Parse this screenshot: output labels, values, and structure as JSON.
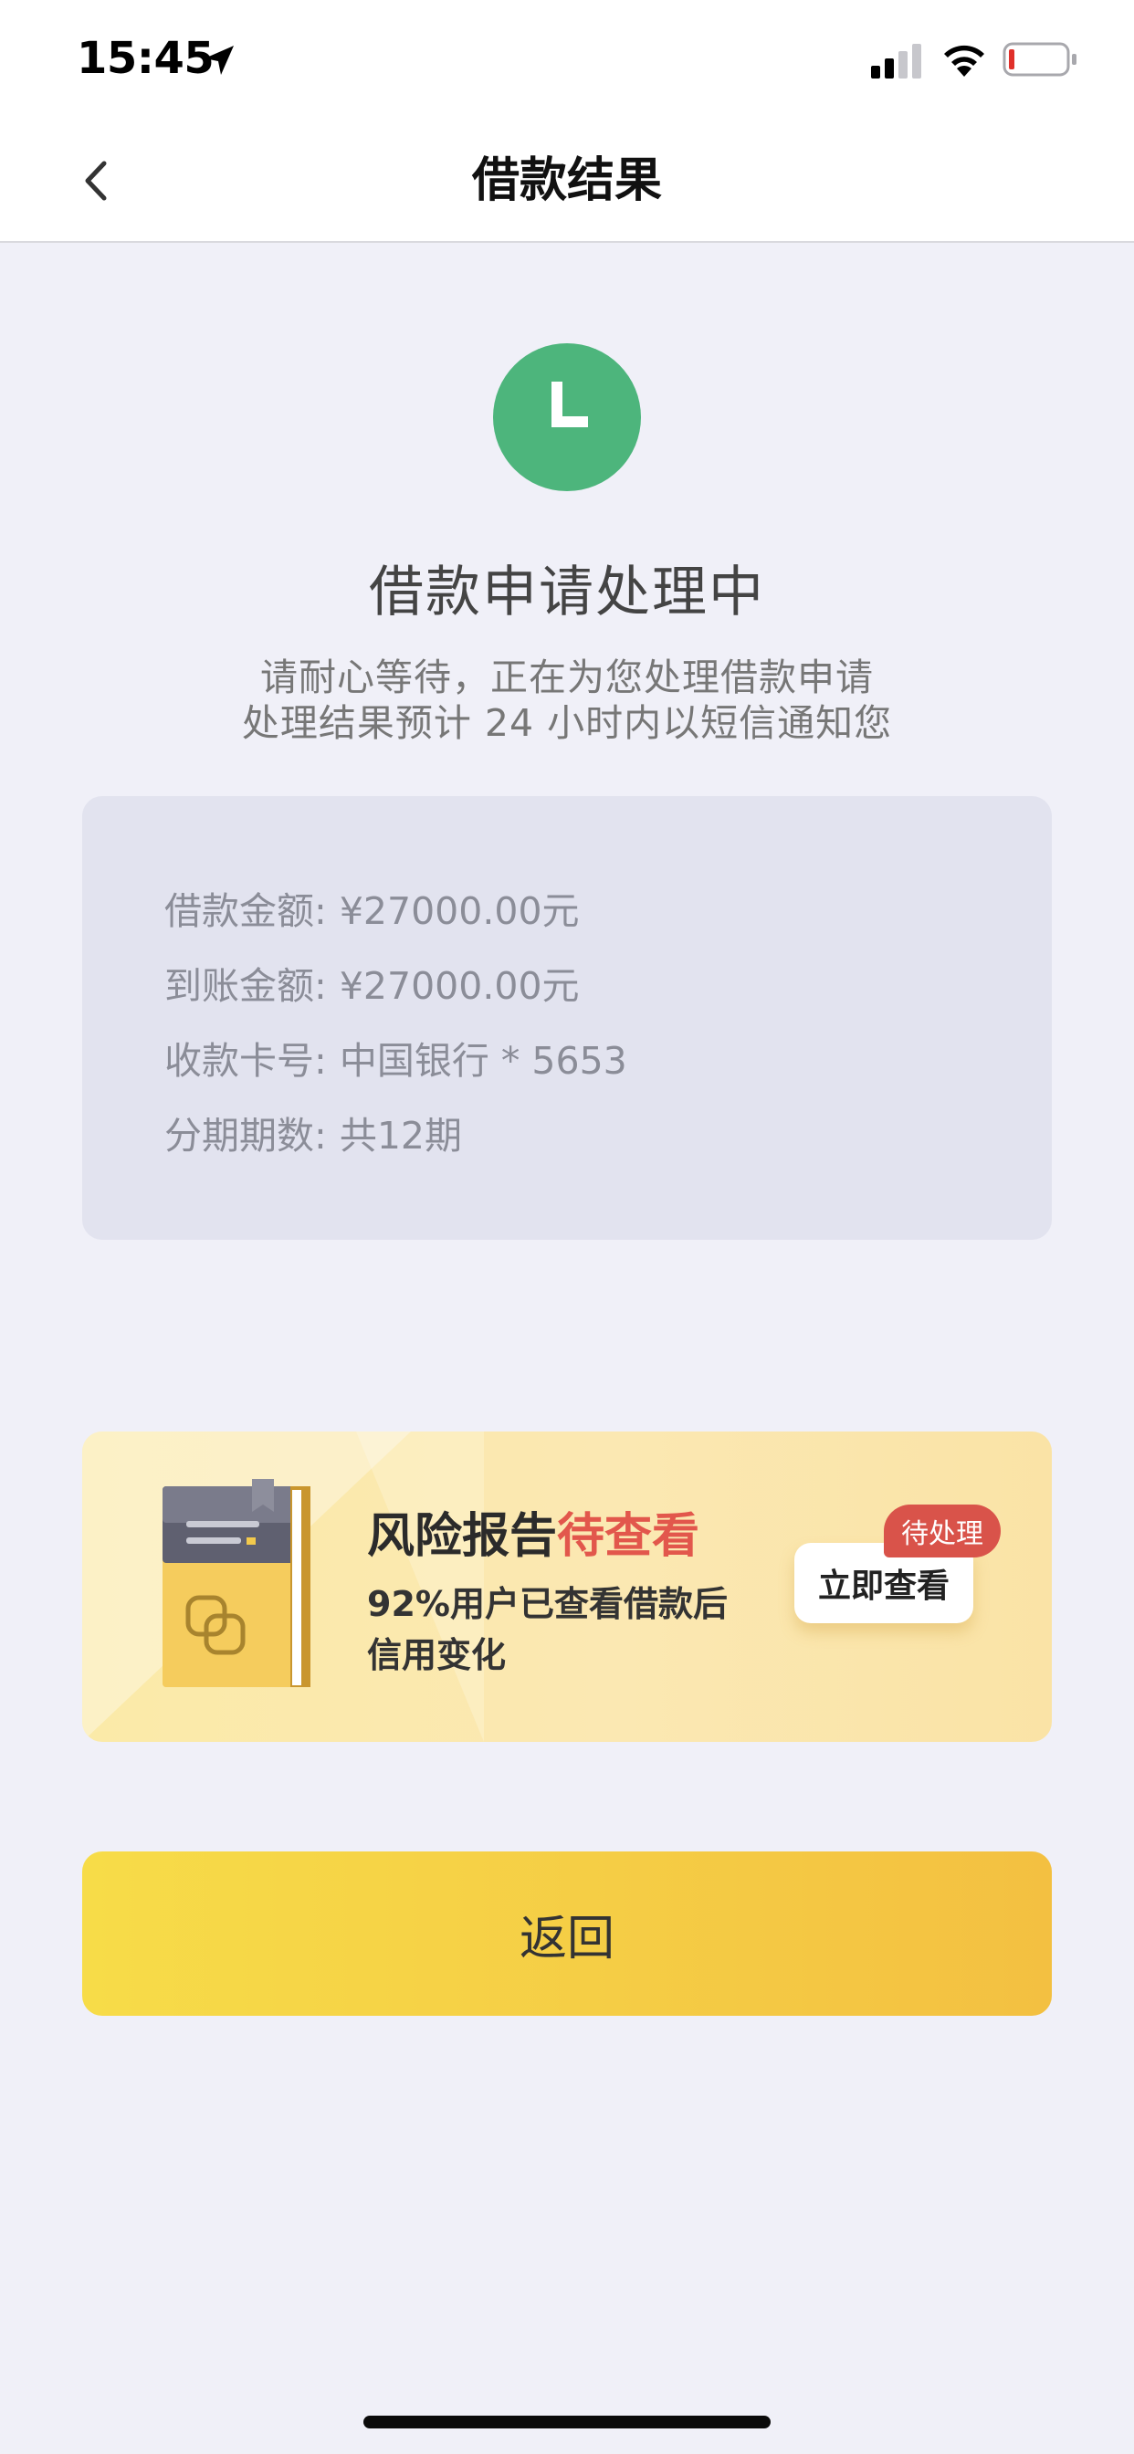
{
  "status_bar": {
    "time": "15:45",
    "icons": [
      "location-arrow-icon",
      "cellular-signal-icon",
      "wifi-icon",
      "battery-low-icon"
    ]
  },
  "nav": {
    "title": "借款结果",
    "back_icon": "chevron-left-icon"
  },
  "status": {
    "icon": "clock-icon",
    "icon_color": "#4db57c",
    "heading": "借款申请处理中",
    "description_lines": [
      "请耐心等待，正在为您处理借款申请",
      "处理结果预计 24 小时内以短信通知您"
    ]
  },
  "loan_details": [
    {
      "label": "借款金额:",
      "value": "¥27000.00元"
    },
    {
      "label": "到账金额:",
      "value": "¥27000.00元"
    },
    {
      "label": "收款卡号:",
      "value": "中国银行 * 5653"
    },
    {
      "label": "分期期数:",
      "value": "共12期"
    }
  ],
  "risk_banner": {
    "icon": "report-book-icon",
    "title_prefix": "风险报告",
    "title_highlight": "待查看",
    "subtitle_lines": [
      "92%用户已查看借款后",
      "信用变化"
    ],
    "badge": "待处理",
    "button_label": "立即查看",
    "highlight_color": "#e2574c"
  },
  "actions": {
    "return_label": "返回"
  }
}
